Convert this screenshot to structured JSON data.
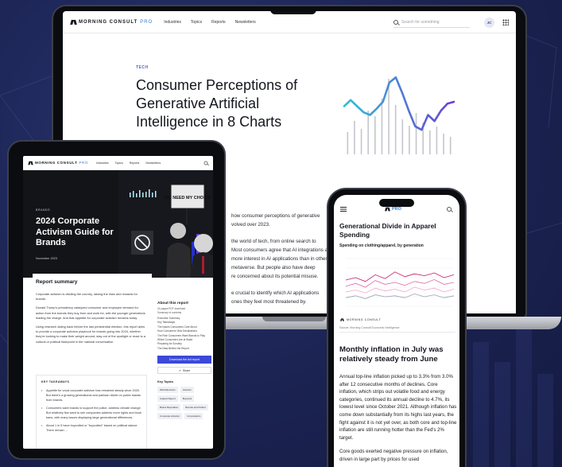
{
  "colors": {
    "background": "#1b2352",
    "accent_blue": "#3b49d8",
    "chart_purple": "#6b3fd6",
    "chart_teal": "#2fc0d4",
    "bar_gray": "#c4c6cc"
  },
  "laptop": {
    "brand": "MORNING CONSULT",
    "brand_suffix": "PRO",
    "nav": [
      "Industries",
      "Topics",
      "Reports",
      "Newsletters"
    ],
    "search_placeholder": "Search for something",
    "avatar_initials": "JC",
    "tag": "TECH",
    "headline": "Consumer Perceptions of Generative Artificial Intelligence in 8 Charts",
    "article_lines": [
      "how consumer perceptions of generative",
      "volved over 2023.",
      "",
      "the world of tech, from online search to",
      "Most consumers agree that AI integrations a",
      "more interest in AI applications than in other",
      "metaverse. But people also have deep",
      "re concerned about its potential misuse.",
      "",
      "e crucial to identify which AI applications",
      "ones they feel most threatened by."
    ]
  },
  "tablet": {
    "brand": "MORNING CONSULT",
    "brand_suffix": "PRO",
    "nav": [
      "Industries",
      "Topics",
      "Reports",
      "Newsletters"
    ],
    "hero_tag": "BRANDS",
    "hero_headline": "2024 Corporate Activism Guide for Brands",
    "hero_date": "November 2023",
    "sign_text": "WE NEED MY CHOICE",
    "report_title": "Report summary",
    "paragraphs": [
      "Corporate activism is dividing the country, raising the risks and rewards for brands.",
      "Donald Trump's presidency catalyzed consumer and employee demand for action from the brands they buy from and work for, with the younger generations leading the charge. And that appetite for corporate activism remains today.",
      "Using research dating back before the last presidential election, this report aims to provide a corporate activism playbook for brands going into 2024, whether they're looking to make their weight around, stay out of the spotlight or react to a cultural or political flashpoint in the national conversation."
    ],
    "takeaways_title": "KEY TAKEAWAYS",
    "takeaways": [
      "Appetite for vocal corporate activism has remained steady since 2020. But there's a growing generational and partisan divide on public stands from brands.",
      "Consumers want brands to support the police, address climate change. But relatively few want to see companies address more rights and book bans, with many issues displaying large generational differences.",
      "About 1 in 5 have boycotted or \"buycotted\" based on political stance. There remain ..."
    ],
    "side": {
      "title": "About this report",
      "meta": [
        "24-pages PDF download",
        "Summary of contents"
      ],
      "toc": [
        "Executive Summary",
        "Key Takeaways",
        "The Issues Consumers Care About",
        "How Consumers View Declarations",
        "The Role Consumers Want Brands to Play",
        "Which Consumers Are at Stake",
        "Preparing for Scrutiny",
        "The Data Behind the Report"
      ],
      "download_label": "Download the full report",
      "share_label": "Share",
      "topics_title": "Key Topics",
      "topics": [
        "2024 Elections",
        "Activism",
        "Analyst Report",
        "Boycotts",
        "Brand Reputation",
        "Brands and Politics",
        "Corporate Activism",
        "Corporations"
      ]
    }
  },
  "phone": {
    "brand_suffix": "PRO",
    "chart_title": "Generational Divide in Apparel Spending",
    "chart_subtitle": "Spending on clothing/apparel, by generation",
    "logo_text": "MORNING CONSULT",
    "source": "Source: Morning Consult Economic Intelligence",
    "headline": "Monthly inflation in July was relatively steady from June",
    "body": [
      "Annual top-line inflation picked up to 3.3% from 3.0% after 12 consecutive months of declines. Core inflation, which strips out volatile food and energy categories, continued its annual decline to 4.7%, its lowest level since October 2021. Although inflation has come down substantially from its highs last years, the fight against it is not yet over, as both core and top-line inflation are still running hotter than the Fed's 2% target.",
      "Core goods exerted negative pressure on inflation, driven in large part by prices for used"
    ]
  },
  "chart_data": [
    {
      "type": "line",
      "values": [
        0.55,
        0.62,
        0.55,
        0.48,
        0.45,
        0.52,
        0.6,
        0.82,
        0.88,
        0.7,
        0.5,
        0.32,
        0.28,
        0.45,
        0.38,
        0.5,
        0.58,
        0.6
      ],
      "bars": [
        0.28,
        0.42,
        0.32,
        0.55,
        0.48,
        0.7,
        0.95,
        0.62,
        0.44,
        0.36,
        0.52,
        0.4,
        0.3,
        0.35,
        0.26,
        0.22
      ],
      "ylim": [
        0,
        1
      ]
    },
    {
      "type": "line",
      "title": "Generational Divide in Apparel Spending",
      "subtitle": "Spending on clothing/apparel, by generation",
      "ylim": [
        0,
        100
      ],
      "series": [
        {
          "color": "#c0186b",
          "values": [
            55,
            60,
            52,
            66,
            58,
            72,
            62,
            68,
            64,
            70,
            60,
            66
          ]
        },
        {
          "color": "#e26aa6",
          "values": [
            42,
            48,
            40,
            54,
            46,
            50,
            44,
            52,
            48,
            56,
            46,
            50
          ]
        },
        {
          "color": "#f0a8cc",
          "values": [
            30,
            34,
            28,
            38,
            32,
            36,
            30,
            40,
            34,
            38,
            30,
            36
          ]
        },
        {
          "color": "#9aa0b0",
          "values": [
            18,
            22,
            16,
            24,
            20,
            22,
            18,
            26,
            20,
            24,
            18,
            22
          ]
        }
      ]
    }
  ]
}
